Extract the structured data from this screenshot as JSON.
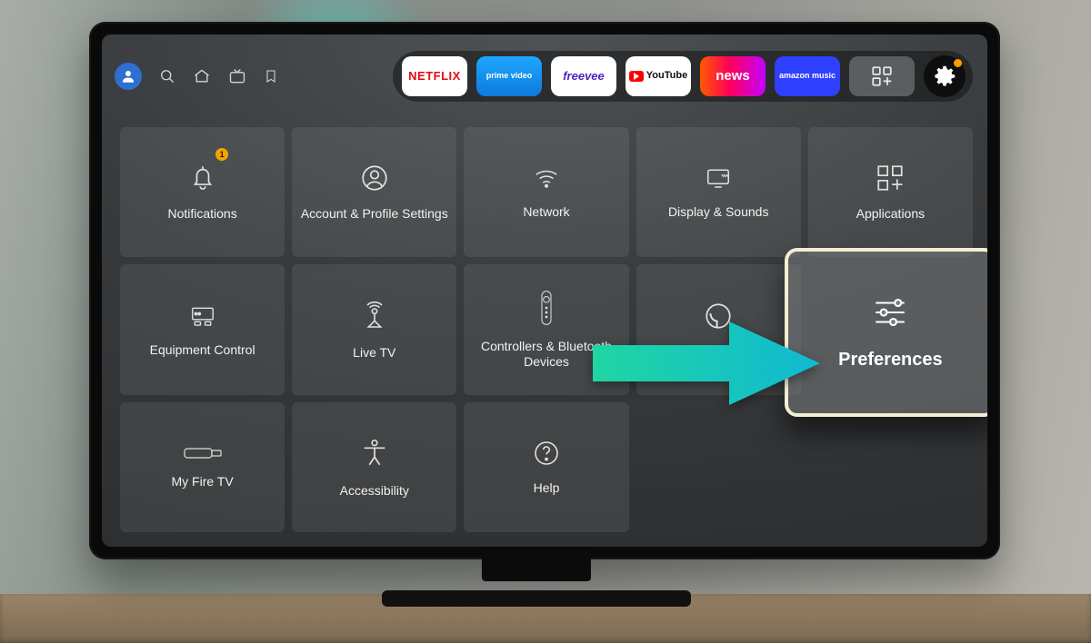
{
  "platform": "Fire TV",
  "screen_title": "Settings",
  "nav": {
    "profile_icon": "profile-icon",
    "icons": [
      "search-icon",
      "home-icon",
      "live-tv-icon",
      "bookmark-icon"
    ]
  },
  "app_strip": [
    {
      "id": "netflix",
      "label": "NETFLIX"
    },
    {
      "id": "prime-video",
      "label": "prime video"
    },
    {
      "id": "freevee",
      "label": "freevee"
    },
    {
      "id": "youtube",
      "label": "YouTube"
    },
    {
      "id": "news",
      "label": "news"
    },
    {
      "id": "amazon-music",
      "label": "amazon music"
    },
    {
      "id": "apps-grid",
      "label": ""
    }
  ],
  "settings_active_indicator": true,
  "tiles": {
    "notifications": {
      "label": "Notifications",
      "badge": "1"
    },
    "account": {
      "label": "Account & Profile Settings"
    },
    "network": {
      "label": "Network"
    },
    "display": {
      "label": "Display & Sounds"
    },
    "applications": {
      "label": "Applications"
    },
    "equipment": {
      "label": "Equipment Control"
    },
    "livetv": {
      "label": "Live TV"
    },
    "controllers": {
      "label": "Controllers & Bluetooth Devices"
    },
    "alexa": {
      "label": "Alexa"
    },
    "preferences": {
      "label": "Preferences",
      "selected": true
    },
    "myfiretv": {
      "label": "My Fire TV"
    },
    "accessibility": {
      "label": "Accessibility"
    },
    "help": {
      "label": "Help"
    }
  },
  "annotation": {
    "arrow_points_to": "preferences",
    "arrow_color_start": "#1fd6a3",
    "arrow_color_end": "#16b7cf"
  }
}
